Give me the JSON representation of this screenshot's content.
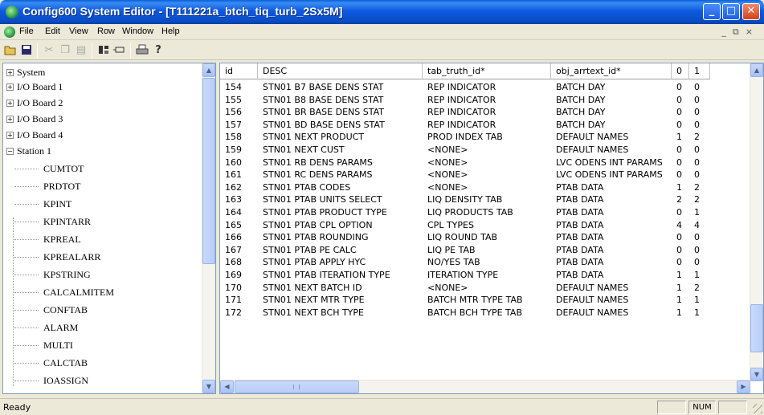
{
  "window": {
    "title": "Config600 System Editor - [T111221a_btch_tiq_turb_2Sx5M]"
  },
  "menu": {
    "items": [
      "File",
      "Edit",
      "View",
      "Row",
      "Window",
      "Help"
    ],
    "mdi_controls": [
      "_",
      "⧉",
      "×"
    ]
  },
  "toolbar": {
    "icons": [
      "open-folder-icon",
      "save-icon",
      "cut-icon",
      "copy-icon",
      "paste-icon",
      "batch-icon",
      "io-icon",
      "print-icon",
      "help-icon"
    ]
  },
  "tree": {
    "items": [
      {
        "label": "System",
        "toggle": "+"
      },
      {
        "label": "I/O Board 1",
        "toggle": "+"
      },
      {
        "label": "I/O Board 2",
        "toggle": "+"
      },
      {
        "label": "I/O Board 3",
        "toggle": "+"
      },
      {
        "label": "I/O Board 4",
        "toggle": "+"
      },
      {
        "label": "Station 1",
        "toggle": "−"
      }
    ],
    "children": [
      "CUMTOT",
      "PRDTOT",
      "KPINT",
      "KPINTARR",
      "KPREAL",
      "KPREALARR",
      "KPSTRING",
      "CALCALMITEM",
      "CONFTAB",
      "ALARM",
      "MULTI",
      "CALCTAB",
      "IOASSIGN"
    ]
  },
  "grid": {
    "columns": [
      "id",
      "DESC",
      "tab_truth_id*",
      "obj_arrtext_id*",
      "0",
      "1"
    ],
    "rows": [
      [
        "154",
        "STN01 B7 BASE DENS STAT",
        "REP INDICATOR",
        "BATCH DAY",
        "0",
        "0"
      ],
      [
        "155",
        "STN01 B8 BASE DENS STAT",
        "REP INDICATOR",
        "BATCH DAY",
        "0",
        "0"
      ],
      [
        "156",
        "STN01 BR BASE DENS STAT",
        "REP INDICATOR",
        "BATCH DAY",
        "0",
        "0"
      ],
      [
        "157",
        "STN01 BD BASE DENS STAT",
        "REP INDICATOR",
        "BATCH DAY",
        "0",
        "0"
      ],
      [
        "158",
        "STN01 NEXT PRODUCT",
        "PROD INDEX TAB",
        "DEFAULT NAMES",
        "1",
        "2"
      ],
      [
        "159",
        "STN01 NEXT CUST",
        "<NONE>",
        "DEFAULT NAMES",
        "0",
        "0"
      ],
      [
        "160",
        "STN01 RB DENS PARAMS",
        "<NONE>",
        "LVC ODENS INT PARAMS",
        "0",
        "0"
      ],
      [
        "161",
        "STN01 RC DENS PARAMS",
        "<NONE>",
        "LVC ODENS INT PARAMS",
        "0",
        "0"
      ],
      [
        "162",
        "STN01 PTAB CODES",
        "<NONE>",
        "PTAB DATA",
        "1",
        "2"
      ],
      [
        "163",
        "STN01 PTAB UNITS SELECT",
        "LIQ DENSITY TAB",
        "PTAB DATA",
        "2",
        "2"
      ],
      [
        "164",
        "STN01 PTAB PRODUCT TYPE",
        "LIQ PRODUCTS TAB",
        "PTAB DATA",
        "0",
        "1"
      ],
      [
        "165",
        "STN01 PTAB CPL OPTION",
        "CPL TYPES",
        "PTAB DATA",
        "4",
        "4"
      ],
      [
        "166",
        "STN01 PTAB ROUNDING",
        "LIQ ROUND TAB",
        "PTAB DATA",
        "0",
        "0"
      ],
      [
        "167",
        "STN01 PTAB PE CALC",
        "LIQ PE TAB",
        "PTAB DATA",
        "0",
        "0"
      ],
      [
        "168",
        "STN01 PTAB APPLY HYC",
        "NO/YES TAB",
        "PTAB DATA",
        "0",
        "0"
      ],
      [
        "169",
        "STN01 PTAB ITERATION TYPE",
        "ITERATION TYPE",
        "PTAB DATA",
        "1",
        "1"
      ],
      [
        "170",
        "STN01 NEXT BATCH ID",
        "<NONE>",
        "DEFAULT NAMES",
        "1",
        "2"
      ],
      [
        "171",
        "STN01 NEXT MTR TYPE",
        "BATCH MTR TYPE TAB",
        "DEFAULT NAMES",
        "1",
        "1"
      ],
      [
        "172",
        "STN01 NEXT BCH TYPE",
        "BATCH BCH TYPE TAB",
        "DEFAULT NAMES",
        "1",
        "1"
      ]
    ]
  },
  "status": {
    "text": "Ready",
    "num": "NUM"
  }
}
